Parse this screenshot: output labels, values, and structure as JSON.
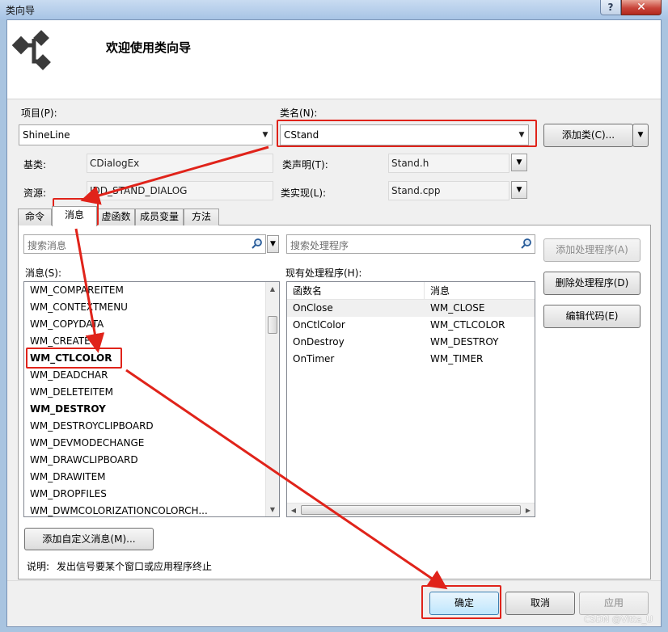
{
  "window": {
    "title": "类向导",
    "help_label": "?",
    "close_label": "✕"
  },
  "header": {
    "welcome": "欢迎使用类向导",
    "icon": "class-wizard-icon"
  },
  "project": {
    "label": "项目(P):",
    "value": "ShineLine"
  },
  "classname": {
    "label": "类名(N):",
    "value": "CStand"
  },
  "add_class": {
    "label": "添加类(C)..."
  },
  "base_class": {
    "label": "基类:",
    "value": "CDialogEx"
  },
  "class_decl": {
    "label": "类声明(T):",
    "value": "Stand.h"
  },
  "resource": {
    "label": "资源:",
    "value": "IDD_STAND_DIALOG"
  },
  "class_impl": {
    "label": "类实现(L):",
    "value": "Stand.cpp"
  },
  "tabs": [
    {
      "label": "命令"
    },
    {
      "label": "消息"
    },
    {
      "label": "虚函数"
    },
    {
      "label": "成员变量"
    },
    {
      "label": "方法"
    }
  ],
  "messages": {
    "search_placeholder": "搜索消息",
    "list_label": "消息(S):",
    "items": [
      {
        "text": "WM_COMPAREITEM",
        "bold": false
      },
      {
        "text": "WM_CONTEXTMENU",
        "bold": false
      },
      {
        "text": "WM_COPYDATA",
        "bold": false
      },
      {
        "text": "WM_CREATE",
        "bold": false
      },
      {
        "text": "WM_CTLCOLOR",
        "bold": true
      },
      {
        "text": "WM_DEADCHAR",
        "bold": false
      },
      {
        "text": "WM_DELETEITEM",
        "bold": false
      },
      {
        "text": "WM_DESTROY",
        "bold": true
      },
      {
        "text": "WM_DESTROYCLIPBOARD",
        "bold": false
      },
      {
        "text": "WM_DEVMODECHANGE",
        "bold": false
      },
      {
        "text": "WM_DRAWCLIPBOARD",
        "bold": false
      },
      {
        "text": "WM_DRAWITEM",
        "bold": false
      },
      {
        "text": "WM_DROPFILES",
        "bold": false
      },
      {
        "text": "WM_DWMCOLORIZATIONCOLORCH...",
        "bold": false
      }
    ],
    "add_custom": "添加自定义消息(M)..."
  },
  "handlers": {
    "search_placeholder": "搜索处理程序",
    "list_label": "现有处理程序(H):",
    "col_function": "函数名",
    "col_message": "消息",
    "rows": [
      {
        "function": "OnClose",
        "message": "WM_CLOSE"
      },
      {
        "function": "OnCtlColor",
        "message": "WM_CTLCOLOR"
      },
      {
        "function": "OnDestroy",
        "message": "WM_DESTROY"
      },
      {
        "function": "OnTimer",
        "message": "WM_TIMER"
      }
    ]
  },
  "side_buttons": {
    "add_handler": "添加处理程序(A)",
    "delete_handler": "删除处理程序(D)",
    "edit_code": "编辑代码(E)"
  },
  "description": {
    "label": "说明:",
    "text": "发出信号要某个窗口或应用程序终止"
  },
  "footer": {
    "ok": "确定",
    "cancel": "取消",
    "apply": "应用"
  },
  "watermark": "CSDN @Vitta_U",
  "colors": {
    "highlight": "#e0231a",
    "accent": "#3c7fb1"
  }
}
